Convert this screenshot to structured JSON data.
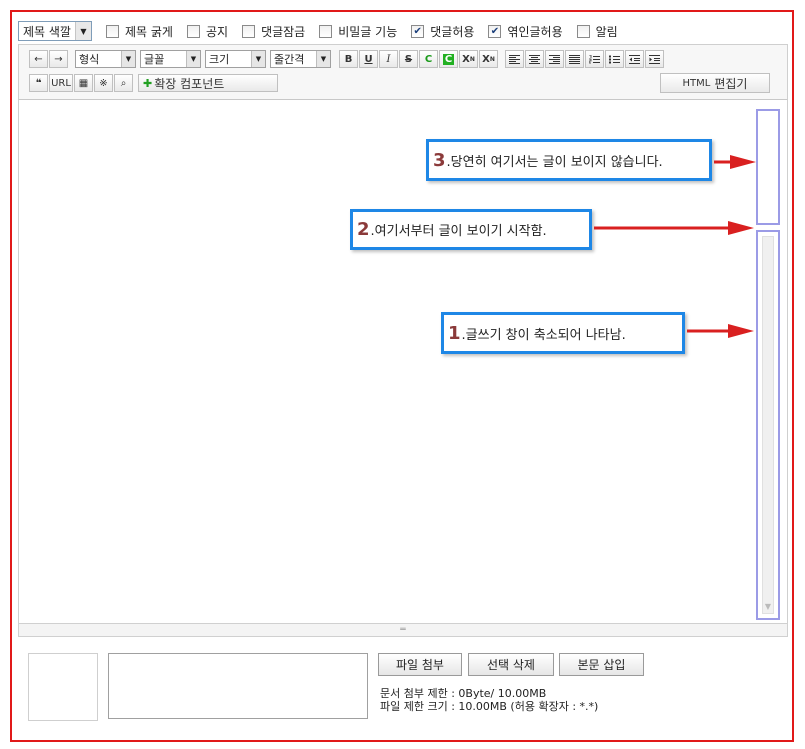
{
  "options": {
    "title_color_select": "제목 색깔",
    "checkboxes": [
      {
        "label": "제목 굵게",
        "checked": false
      },
      {
        "label": "공지",
        "checked": false
      },
      {
        "label": "댓글잠금",
        "checked": false
      },
      {
        "label": "비밀글 기능",
        "checked": false
      },
      {
        "label": "댓글허용",
        "checked": true
      },
      {
        "label": "엮인글허용",
        "checked": true
      },
      {
        "label": "알림",
        "checked": false
      }
    ]
  },
  "toolbar": {
    "undo_icon": "←",
    "redo_icon": "→",
    "format_select": "형식",
    "font_select": "글꼴",
    "size_select": "크기",
    "line_height_select": "줄간격",
    "bold": "B",
    "underline": "U",
    "italic": "I",
    "strike": "S",
    "font_color": "C",
    "bg_color": "C",
    "superscript": "X",
    "superscript_mark": "N",
    "subscript": "X",
    "subscript_mark": "N",
    "quote": "❝",
    "url": "URL",
    "table_icon": "▦",
    "special_char": "※",
    "search_icon": "⌕",
    "extension_plus": "✚",
    "extension_label": "확장 컴포넌트",
    "html_prefix": "HTML",
    "html_label": "편집기",
    "resize_handle": "═"
  },
  "annotations": {
    "note3": {
      "num": "3",
      "text": ".당연히 여기서는 글이 보이지 않습니다."
    },
    "note2": {
      "num": "2",
      "text": ".여기서부터 글이 보이기 시작함."
    },
    "note1": {
      "num": "1",
      "text": ".글쓰기 창이 축소되어 나타남."
    }
  },
  "attachment": {
    "attach_button": "파일 첨부",
    "delete_button": "선택 삭제",
    "insert_button": "본문 삽입",
    "doc_limit": "문서 첨부 제한 : 0Byte/ 10.00MB",
    "file_limit": "파일 제한 크기 : 10.00MB (허용 확장자 : *.*)"
  },
  "colors": {
    "frame_red": "#e11919",
    "callout_blue": "#1e87e6",
    "arrow_red": "#d92020",
    "scroll_highlight": "#9b9be6"
  }
}
